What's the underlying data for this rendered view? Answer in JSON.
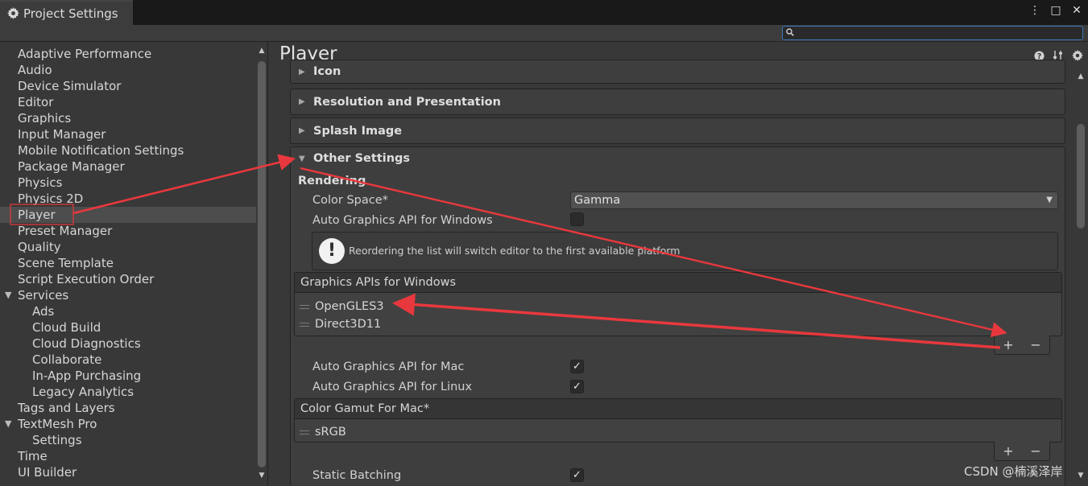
{
  "window": {
    "title": "Project Settings",
    "controls": [
      "⋮",
      "□",
      "✕"
    ]
  },
  "search": {
    "placeholder": "",
    "value": ""
  },
  "sidebar": {
    "items": [
      {
        "label": "Adaptive Performance",
        "level": 0
      },
      {
        "label": "Audio",
        "level": 0
      },
      {
        "label": "Device Simulator",
        "level": 0
      },
      {
        "label": "Editor",
        "level": 0
      },
      {
        "label": "Graphics",
        "level": 0
      },
      {
        "label": "Input Manager",
        "level": 0
      },
      {
        "label": "Mobile Notification Settings",
        "level": 0
      },
      {
        "label": "Package Manager",
        "level": 0
      },
      {
        "label": "Physics",
        "level": 0
      },
      {
        "label": "Physics 2D",
        "level": 0
      },
      {
        "label": "Player",
        "level": 0,
        "selected": true
      },
      {
        "label": "Preset Manager",
        "level": 0
      },
      {
        "label": "Quality",
        "level": 0
      },
      {
        "label": "Scene Template",
        "level": 0
      },
      {
        "label": "Script Execution Order",
        "level": 0
      },
      {
        "label": "Services",
        "level": 0,
        "foldout": "expanded"
      },
      {
        "label": "Ads",
        "level": 1
      },
      {
        "label": "Cloud Build",
        "level": 1
      },
      {
        "label": "Cloud Diagnostics",
        "level": 1
      },
      {
        "label": "Collaborate",
        "level": 1
      },
      {
        "label": "In-App Purchasing",
        "level": 1
      },
      {
        "label": "Legacy Analytics",
        "level": 1
      },
      {
        "label": "Tags and Layers",
        "level": 0
      },
      {
        "label": "TextMesh Pro",
        "level": 0,
        "foldout": "expanded"
      },
      {
        "label": "Settings",
        "level": 1
      },
      {
        "label": "Time",
        "level": 0
      },
      {
        "label": "UI Builder",
        "level": 0
      }
    ]
  },
  "main": {
    "title": "Player",
    "sections": {
      "icon": "Icon",
      "resolution": "Resolution and Presentation",
      "splash": "Splash Image",
      "other": "Other Settings"
    },
    "rendering": {
      "heading": "Rendering",
      "color_space_label": "Color Space*",
      "color_space_value": "Gamma",
      "auto_api_windows_label": "Auto Graphics API  for Windows",
      "auto_api_windows_checked": false,
      "help_text": "Reordering the list will switch editor to the first available platform",
      "graphics_apis_header": "Graphics APIs for Windows",
      "graphics_apis": [
        "OpenGLES3",
        "Direct3D11"
      ],
      "auto_api_mac_label": "Auto Graphics API  for Mac",
      "auto_api_mac_checked": true,
      "auto_api_linux_label": "Auto Graphics API  for Linux",
      "auto_api_linux_checked": true,
      "color_gamut_header": "Color Gamut For Mac*",
      "color_gamut_items": [
        "sRGB"
      ],
      "static_batching_label": "Static Batching",
      "static_batching_checked": true,
      "add_symbol": "+",
      "remove_symbol": "−",
      "check_symbol": "✓"
    }
  },
  "annotation_colors": {
    "arrow": "#e8383d"
  },
  "watermark": "CSDN @楠溪泽岸"
}
